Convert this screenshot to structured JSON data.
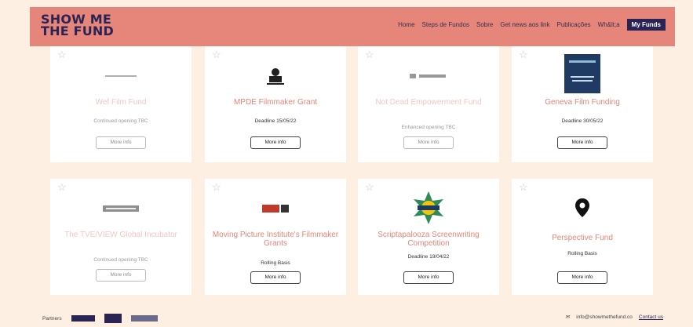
{
  "header": {
    "logo_line1": "SHOW ME",
    "logo_line2": "THE FUND",
    "nav": [
      "Home",
      "Steps de Fundos",
      "Sobre",
      "Get news aos link",
      "Publicações",
      "Wh&lt;a",
      "My Funds"
    ]
  },
  "cards": [
    {
      "title": "Wef Film Fund",
      "meta": "Continued opening TBC",
      "button": "More info",
      "faded": true
    },
    {
      "title": "MPDE Filmmaker Grant",
      "meta": "Deadline 15/05/22",
      "button": "More info",
      "faded": false
    },
    {
      "title": "Not Dead Empowerment Fund",
      "meta": "Enhanced opening TBC",
      "button": "More info",
      "faded": true
    },
    {
      "title": "Geneva Film Funding",
      "meta": "Deadline 30/05/22",
      "button": "More info",
      "faded": false
    },
    {
      "title": "The TVE/VIEW Global Incubator",
      "meta": "Continued opening TBC",
      "button": "More info",
      "faded": true
    },
    {
      "title": "Moving Picture Institute's Filmmaker Grants",
      "meta": "Rolling Basis",
      "button": "More info",
      "faded": false
    },
    {
      "title": "Scriptapalooza Screenwriting Competition",
      "meta": "Deadline 19/04/22",
      "button": "More info",
      "faded": false
    },
    {
      "title": "Perspective Fund",
      "meta": "Rolling Basis",
      "button": "More info",
      "faded": false
    }
  ],
  "footer": {
    "powered": "Partners",
    "email": "info@showmethefund.co",
    "contact": "Contact us"
  },
  "colors": {
    "header_bg": "#e6867a",
    "page_bg": "#fdf0e2",
    "title_color": "#e28678",
    "brand_navy": "#2a2455"
  }
}
